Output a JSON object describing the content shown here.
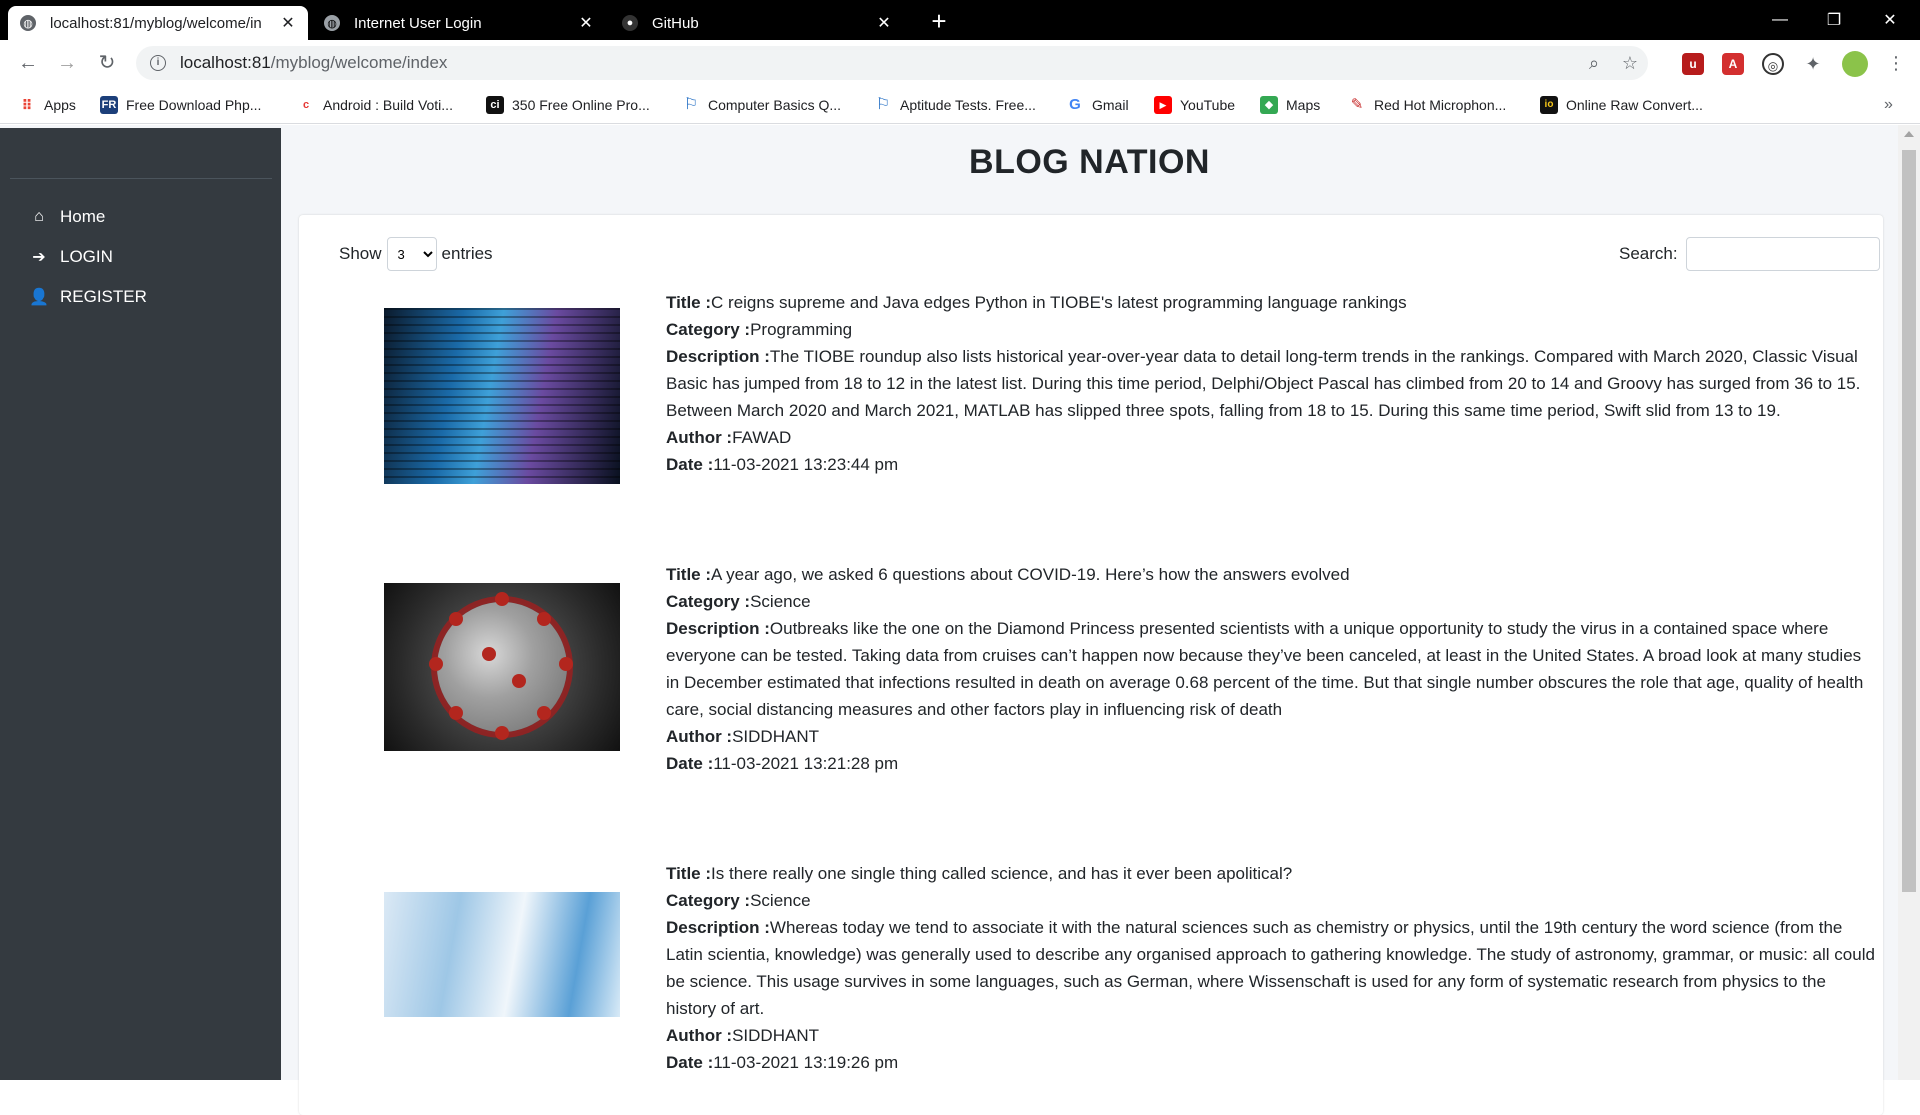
{
  "browser": {
    "tabs": [
      {
        "title": "localhost:81/myblog/welcome/in",
        "active": true
      },
      {
        "title": "Internet User Login",
        "active": false
      },
      {
        "title": "GitHub",
        "active": false
      }
    ],
    "url_host": "localhost:81",
    "url_path": "/myblog/welcome/index",
    "bookmarks": [
      {
        "label": "Apps",
        "icon": "apps-grid-icon",
        "color": "#ea4335"
      },
      {
        "label": "Free Download Php...",
        "icon": "fr-logo-icon",
        "color": "#1c3f7a"
      },
      {
        "label": "Android : Build Voti...",
        "icon": "c-logo-icon",
        "color": "#e53935"
      },
      {
        "label": "350 Free Online Pro...",
        "icon": "ci-logo-icon",
        "color": "#111111"
      },
      {
        "label": "Computer Basics Q...",
        "icon": "flag-logo-icon",
        "color": "#1565c0"
      },
      {
        "label": "Aptitude Tests. Free...",
        "icon": "flag-logo-icon",
        "color": "#1565c0"
      },
      {
        "label": "Gmail",
        "icon": "google-icon",
        "color": "#4285f4"
      },
      {
        "label": "YouTube",
        "icon": "youtube-icon",
        "color": "#ff0000"
      },
      {
        "label": "Maps",
        "icon": "maps-icon",
        "color": "#34a853"
      },
      {
        "label": "Red Hot Microphon...",
        "icon": "microphone-icon",
        "color": "#c62828"
      },
      {
        "label": "Online Raw Convert...",
        "icon": "io-logo-icon",
        "color": "#111111"
      }
    ]
  },
  "sidebar": {
    "items": [
      {
        "label": "Home",
        "icon": "home-icon"
      },
      {
        "label": "LOGIN",
        "icon": "sign-in-icon"
      },
      {
        "label": "REGISTER",
        "icon": "user-plus-icon"
      }
    ]
  },
  "page": {
    "title": "BLOG NATION",
    "show_label": "Show",
    "entries_label": "entries",
    "entries_value": "3",
    "search_label": "Search:"
  },
  "labels": {
    "title": "Title :",
    "category": "Category :",
    "description": "Description :",
    "author": "Author :",
    "date": "Date :"
  },
  "posts": [
    {
      "title": "C reigns supreme and Java edges Python in TIOBE's latest programming language rankings",
      "category": "Programming",
      "description": "The TIOBE roundup also lists historical year-over-year data to detail long-term trends in the rankings. Compared with March 2020, Classic Visual Basic has jumped from 18 to 12 in the latest list. During this time period, Delphi/Object Pascal has climbed from 20 to 14 and Groovy has surged from 36 to 15. Between March 2020 and March 2021, MATLAB has slipped three spots, falling from 18 to 15. During this same time period, Swift slid from 13 to 19.",
      "author": "FAWAD",
      "date": "11-03-2021 13:23:44 pm"
    },
    {
      "title": "A year ago, we asked 6 questions about COVID-19. Here’s how the answers evolved",
      "category": "Science",
      "description": "Outbreaks like the one on the Diamond Princess presented scientists with a unique opportunity to study the virus in a contained space where everyone can be tested. Taking data from cruises can’t happen now because they’ve been canceled, at least in the United States. A broad look at many studies in December estimated that infections resulted in death on average 0.68 percent of the time. But that single number obscures the role that age, quality of health care, social distancing measures and other factors play in influencing risk of death",
      "author": "SIDDHANT",
      "date": "11-03-2021 13:21:28 pm"
    },
    {
      "title": "Is there really one single thing called science, and has it ever been apolitical?",
      "category": "Science",
      "description": "Whereas today we tend to associate it with the natural sciences such as chemistry or physics, until the 19th century the word science (from the Latin scientia, knowledge) was generally used to describe any organised approach to gathering knowledge. The study of astronomy, grammar, or music: all could be science. This usage survives in some languages, such as German, where Wissenschaft is used for any form of systematic research from physics to the history of art.",
      "author": "SIDDHANT",
      "date": "11-03-2021 13:19:26 pm"
    }
  ]
}
